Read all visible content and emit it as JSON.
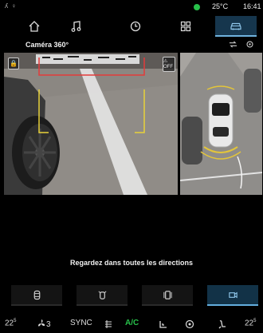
{
  "status": {
    "left_icons": "ʎ ♀",
    "temperature": "25°C",
    "time": "16:41",
    "indicator_color": "#27c04a"
  },
  "nav": {
    "items": [
      "home-icon",
      "music-icon",
      "phone-icon",
      "apps-icon",
      "car-icon"
    ],
    "active": "car-icon"
  },
  "page": {
    "title": "Caméra 360°"
  },
  "camera": {
    "front_view_badge": "🔒",
    "warning_badge": "⚠ OFF"
  },
  "message": "Regardez dans toutes les directions",
  "view_selector": {
    "items": [
      "front-camera-view",
      "top-camera-view",
      "side-camera-view",
      "parking-camera-view"
    ],
    "active": "parking-camera-view"
  },
  "climate": {
    "left_temp": "22",
    "left_temp_decimal": "5",
    "fan_level": "3",
    "sync_label": "SYNC",
    "ac_label": "A/C",
    "right_temp": "22",
    "right_temp_decimal": "5",
    "ac_color": "#27c04a"
  }
}
